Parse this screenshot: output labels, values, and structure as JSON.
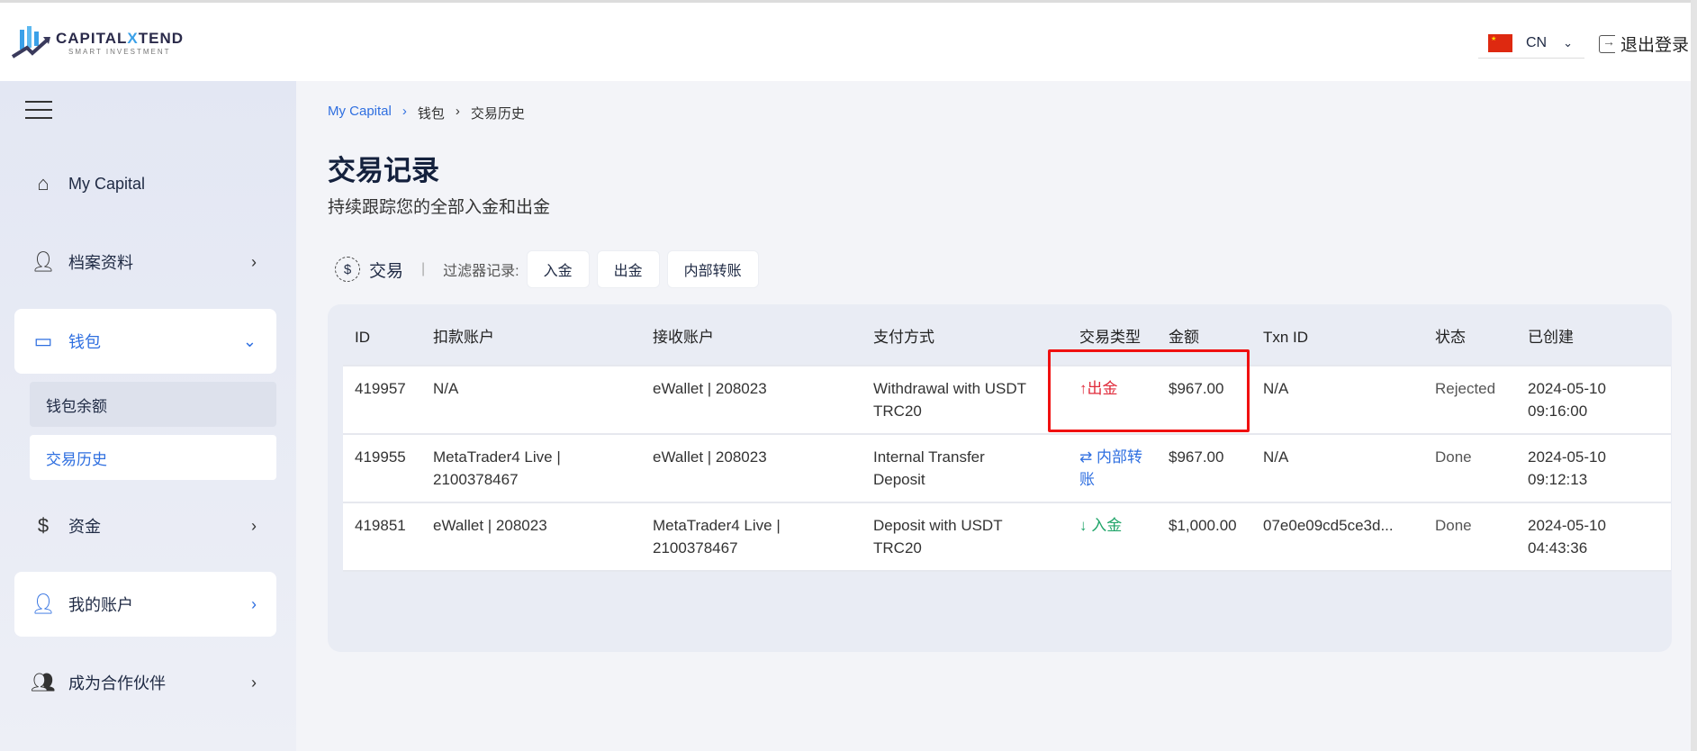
{
  "header": {
    "logo_main": "CAPITAL",
    "logo_x": "X",
    "logo_end": "TEND",
    "logo_sub": "SMART INVESTMENT",
    "lang": "CN",
    "logout": "退出登录"
  },
  "sidebar": {
    "items": [
      {
        "label": "My Capital",
        "icon": "chart-home-icon"
      },
      {
        "label": "档案资料",
        "icon": "user-icon"
      },
      {
        "label": "钱包",
        "icon": "wallet-icon"
      },
      {
        "label": "资金",
        "icon": "money-hand-icon"
      },
      {
        "label": "我的账户",
        "icon": "user-chart-icon"
      },
      {
        "label": "成为合作伙伴",
        "icon": "group-icon"
      }
    ],
    "sub": [
      "钱包余额",
      "交易历史"
    ]
  },
  "breadcrumb": [
    "My Capital",
    "钱包",
    "交易历史"
  ],
  "page": {
    "title": "交易记录",
    "subtitle": "持续跟踪您的全部入金和出金"
  },
  "filters": {
    "label": "交易",
    "filter_label": "过滤器记录:",
    "buttons": [
      "入金",
      "出金",
      "内部转账"
    ]
  },
  "table": {
    "headers": [
      "ID",
      "扣款账户",
      "接收账户",
      "支付方式",
      "交易类型",
      "金额",
      "Txn ID",
      "状态",
      "已创建"
    ],
    "rows": [
      {
        "id": "419957",
        "from": "N/A",
        "to": "eWallet | 208023",
        "method": "Withdrawal with USDT TRC20",
        "type": "出金",
        "type_icon": "↑",
        "amount": "$967.00",
        "txn": "N/A",
        "status": "Rejected",
        "created": "2024-05-10 09:16:00"
      },
      {
        "id": "419955",
        "from": "MetaTrader4 Live | 2100378467",
        "to": "eWallet | 208023",
        "method": "Internal Transfer Deposit",
        "type": "内部转账",
        "type_icon": "⇄",
        "amount": "$967.00",
        "txn": "N/A",
        "status": "Done",
        "created": "2024-05-10 09:12:13"
      },
      {
        "id": "419851",
        "from": "eWallet | 208023",
        "to": "MetaTrader4 Live | 2100378467",
        "method": "Deposit with USDT TRC20",
        "type": "入金",
        "type_icon": "↓",
        "amount": "$1,000.00",
        "txn": "07e0e09cd5ce3d...",
        "status": "Done",
        "created": "2024-05-10 04:43:36"
      }
    ]
  }
}
